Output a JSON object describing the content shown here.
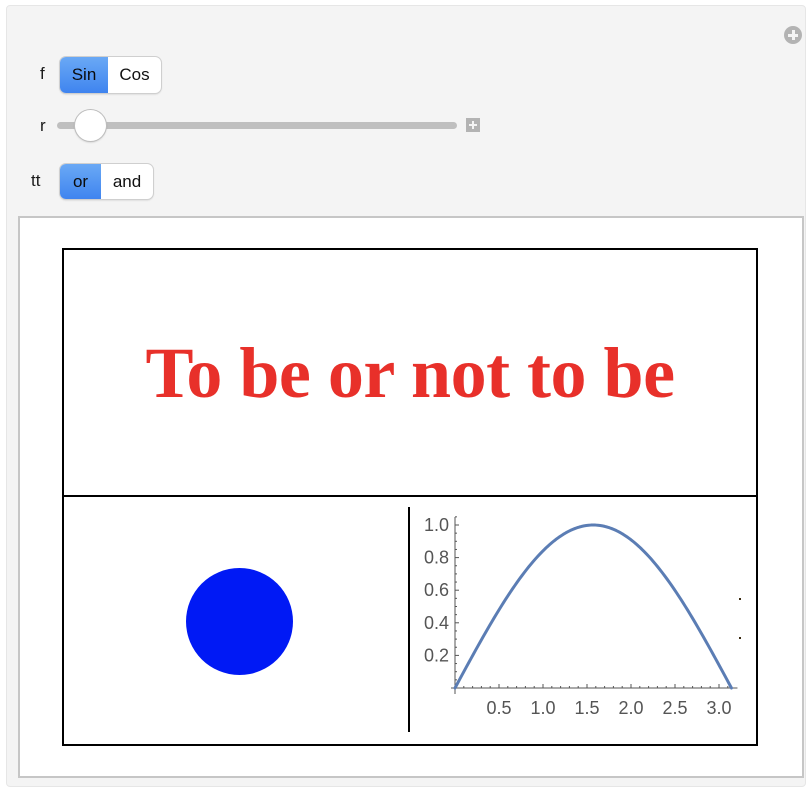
{
  "controls": {
    "f": {
      "label": "f",
      "options": [
        "Sin",
        "Cos"
      ],
      "selected": "Sin"
    },
    "r": {
      "label": "r",
      "value_fraction": 0.05,
      "increment_icon": "plus-square-icon"
    },
    "tt": {
      "label": "tt",
      "options": [
        "or",
        "and"
      ],
      "selected": "or"
    },
    "corner_icon": "plus-circle-icon"
  },
  "output": {
    "title": "To be or not to be",
    "title_color": "#e8302a",
    "circle_color": "#0019f5"
  },
  "chart_data": {
    "type": "line",
    "function": "Sin",
    "title": "",
    "xlabel": "",
    "ylabel": "",
    "xlim": [
      0,
      3.14159
    ],
    "ylim": [
      0,
      1.0
    ],
    "xticks": [
      "0.5",
      "1.0",
      "1.5",
      "2.0",
      "2.5",
      "3.0"
    ],
    "xtick_values": [
      0.5,
      1.0,
      1.5,
      2.0,
      2.5,
      3.0
    ],
    "yticks": [
      "0.2",
      "0.4",
      "0.6",
      "0.8",
      "1.0"
    ],
    "ytick_values": [
      0.2,
      0.4,
      0.6,
      0.8,
      1.0
    ],
    "series": [
      {
        "name": "Sin[x]",
        "color": "#5b7db4",
        "x": [
          0,
          0.1571,
          0.3142,
          0.4712,
          0.6283,
          0.7854,
          0.9425,
          1.0996,
          1.2566,
          1.4137,
          1.5708,
          1.7279,
          1.885,
          2.042,
          2.1991,
          2.3562,
          2.5133,
          2.6704,
          2.8274,
          2.9845,
          3.1416
        ],
        "y": [
          0,
          0.1564,
          0.309,
          0.454,
          0.5878,
          0.7071,
          0.809,
          0.891,
          0.9511,
          0.9877,
          1.0,
          0.9877,
          0.9511,
          0.891,
          0.809,
          0.7071,
          0.5878,
          0.454,
          0.309,
          0.1564,
          0
        ]
      }
    ],
    "grid": false,
    "legend": "none"
  }
}
